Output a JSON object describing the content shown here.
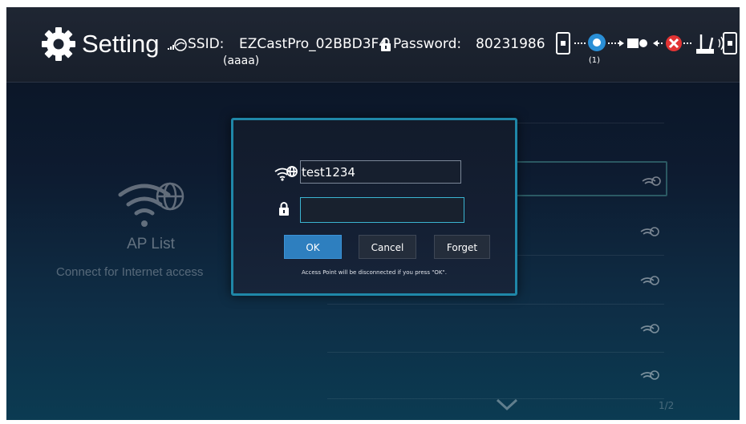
{
  "header": {
    "title": "Setting",
    "ssid_label": "SSID:",
    "ssid_value": "EZCastPro_02BBD3F4",
    "ssid_sub": "(aaaa)",
    "password_label": "Password:",
    "password_value": "80231986",
    "connected_count": "(1)",
    "icons": [
      "gear-icon",
      "wifi-connect-icon",
      "lock-icon",
      "phone-icon",
      "client-device-icon",
      "projector-icon",
      "disconnected-x-icon",
      "router-icon",
      "phone-icon"
    ]
  },
  "background": {
    "ap_title": "AP List",
    "ap_subtitle": "Connect for Internet access",
    "page_indicator": "1/2"
  },
  "dialog": {
    "ssid_value": "test1234",
    "password_value": "",
    "ok_label": "OK",
    "cancel_label": "Cancel",
    "forget_label": "Forget",
    "note": "Access Point will be disconnected if you press \"OK\"."
  },
  "colors": {
    "accent": "#1f87a8",
    "ok_button": "#2e7fbf",
    "disconnected": "#e23434",
    "connected": "#2a8fd6"
  }
}
